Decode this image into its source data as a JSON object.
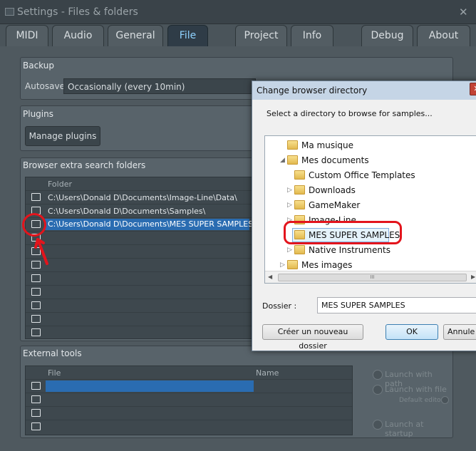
{
  "window": {
    "title": "Settings - Files & folders",
    "tabs": [
      "MIDI",
      "Audio",
      "General",
      "File",
      "Project",
      "Info",
      "Debug",
      "About"
    ],
    "active_tab": "File"
  },
  "backup": {
    "heading": "Backup",
    "autosave_label": "Autosave",
    "autosave_value": "Occasionally (every 10min)"
  },
  "plugins": {
    "heading": "Plugins",
    "manage_label": "Manage plugins"
  },
  "browser_folders": {
    "heading": "Browser extra search folders",
    "column": "Folder",
    "rows": [
      "C:\\Users\\Donald D\\Documents\\Image-Line\\Data\\",
      "C:\\Users\\Donald D\\Documents\\Samples\\",
      "C:\\Users\\Donald D\\Documents\\MES SUPER SAMPLES\\"
    ]
  },
  "external_tools": {
    "heading": "External tools",
    "col_file": "File",
    "col_name": "Name",
    "launch_with_path": "Launch with path",
    "launch_with_file": "Launch with file",
    "default_editor": "Default editor",
    "launch_at_startup": "Launch at startup"
  },
  "dialog": {
    "title": "Change browser directory",
    "prompt": "Select a directory to browse for samples...",
    "tree": [
      "Ma musique",
      "Mes documents",
      "Custom Office Templates",
      "Downloads",
      "GameMaker",
      "Image-Line",
      "MES SUPER SAMPLES",
      "Native Instruments",
      "Mes images"
    ],
    "folder_label": "Dossier :",
    "folder_value": "MES SUPER SAMPLES",
    "new_folder": "Créer un nouveau dossier",
    "ok": "OK",
    "cancel": "Annule",
    "scroll_grip": "III"
  },
  "colors": {
    "accent_tab": "#8fd3ff",
    "selection": "#2a6cb1",
    "annotation": "#e3141c"
  }
}
